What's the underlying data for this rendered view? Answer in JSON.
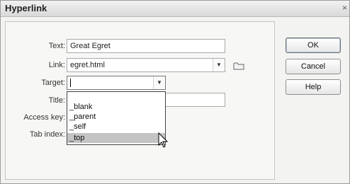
{
  "dialog": {
    "title": "Hyperlink",
    "close_glyph": "×"
  },
  "form": {
    "text": {
      "label": "Text:",
      "value": "Great Egret"
    },
    "link": {
      "label": "Link:",
      "value": "egret.html",
      "icon": "folder-icon"
    },
    "target": {
      "label": "Target:",
      "value": "",
      "options": [
        "_blank",
        "_parent",
        "_self",
        "_top"
      ],
      "selected": "_top"
    },
    "title": {
      "label": "Title:",
      "value": ""
    },
    "access_key": {
      "label": "Access key:"
    },
    "tab_index": {
      "label": "Tab index:"
    },
    "dropdown_arrow": "▼"
  },
  "buttons": {
    "ok": "OK",
    "cancel": "Cancel",
    "help": "Help"
  }
}
